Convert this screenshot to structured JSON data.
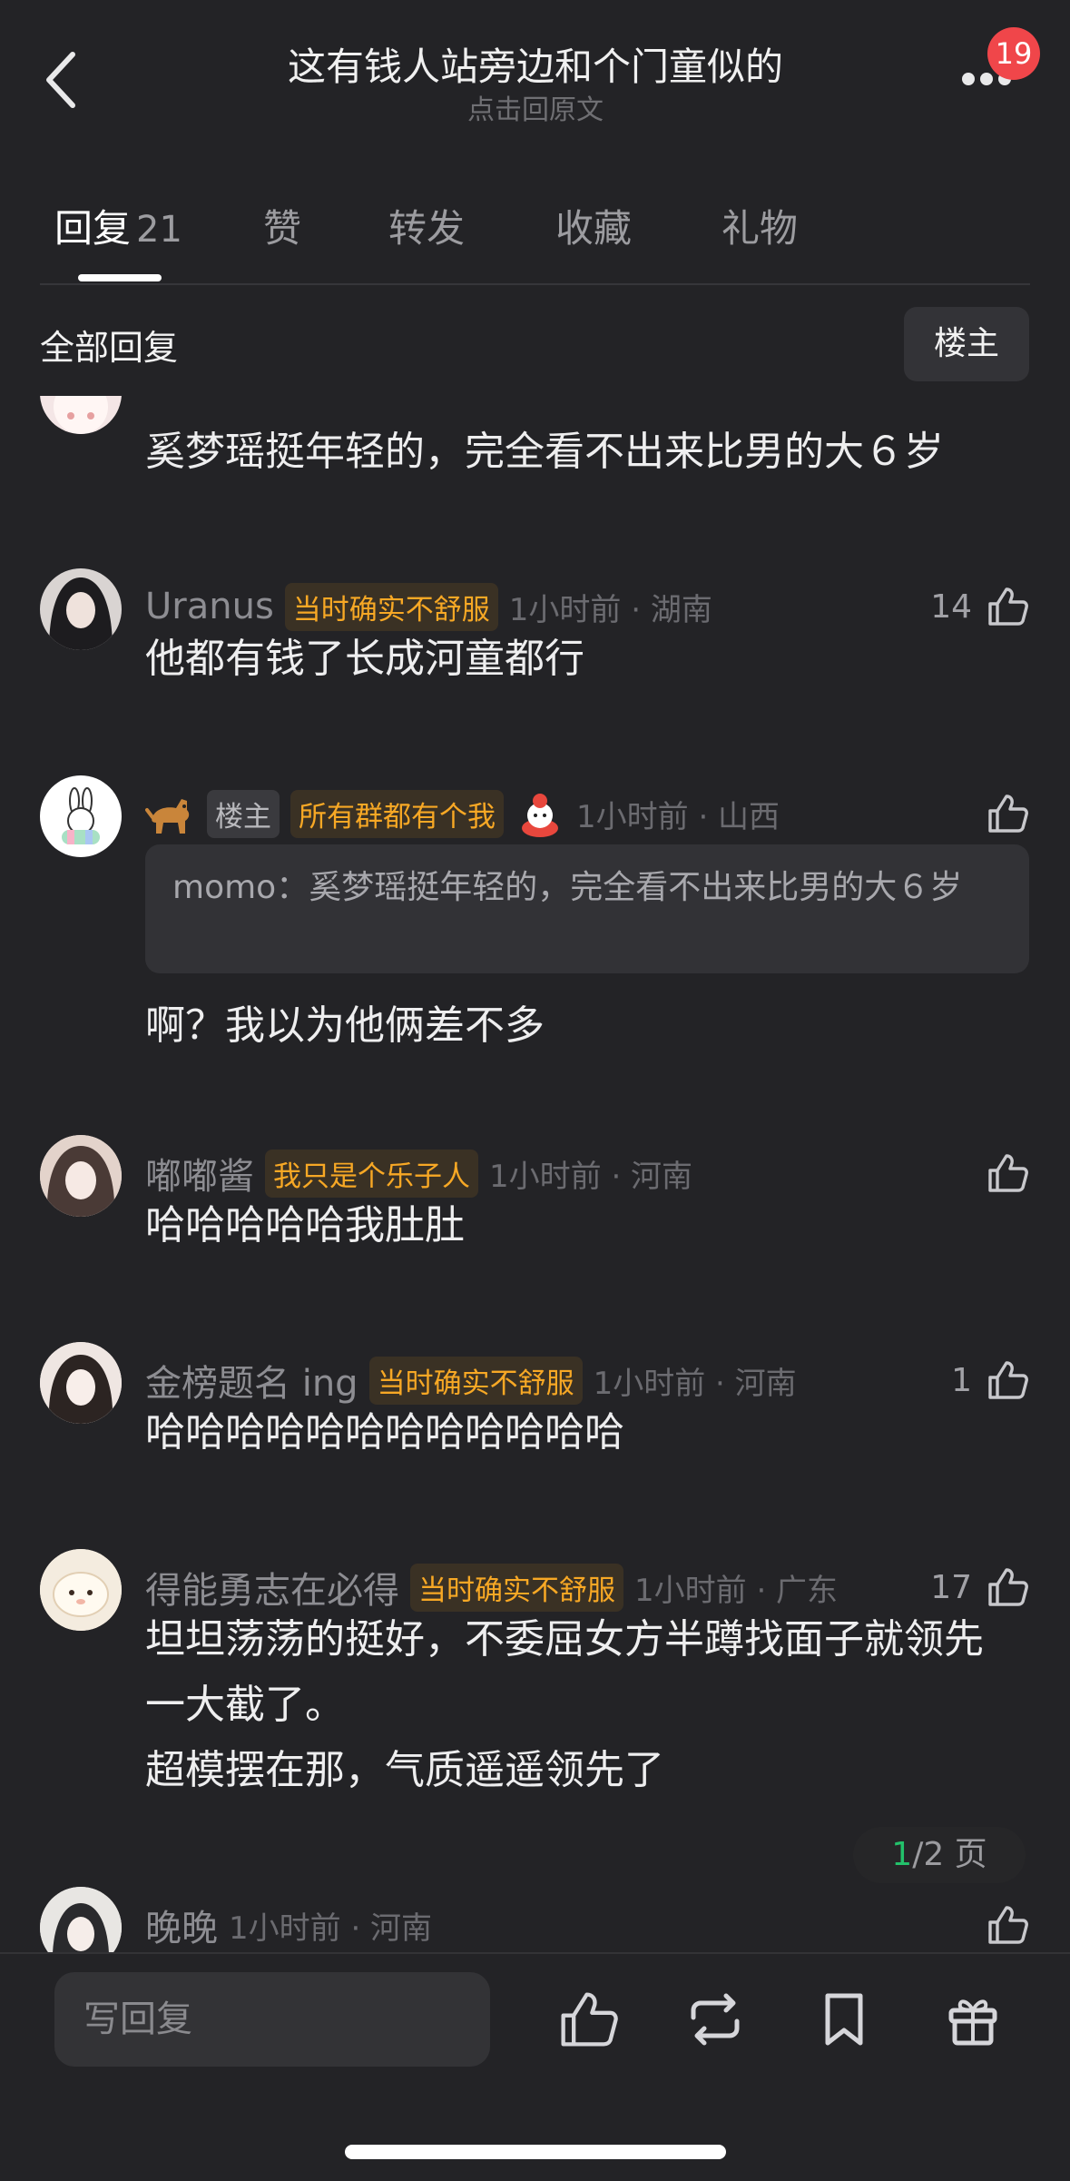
{
  "header": {
    "title": "这有钱人站旁边和个门童似的",
    "subtitle": "点击回原文",
    "notification_count": "19"
  },
  "tabs": [
    {
      "label": "回复",
      "count": "21"
    },
    {
      "label": "赞"
    },
    {
      "label": "转发"
    },
    {
      "label": "收藏"
    },
    {
      "label": "礼物"
    }
  ],
  "filter": {
    "all_replies": "全部回复",
    "op_button": "楼主"
  },
  "comments": [
    {
      "text": "奚梦瑶挺年轻的，完全看不出来比男的大６岁"
    },
    {
      "name": "Uranus",
      "tag": "当时确实不舒服",
      "time": "1小时前 · 湖南",
      "likes": "14",
      "text": "他都有钱了长成河童都行"
    },
    {
      "op_label": "楼主",
      "tag": "所有群都有个我",
      "time": "1小时前 · 山西",
      "quote": "momo：奚梦瑶挺年轻的，完全看不出来比男的大６岁",
      "text": "啊？我以为他俩差不多"
    },
    {
      "name": "嘟嘟酱",
      "tag": "我只是个乐子人",
      "time": "1小时前 · 河南",
      "text": "哈哈哈哈哈我肚肚"
    },
    {
      "name": "金榜题名 ing",
      "tag": "当时确实不舒服",
      "time": "1小时前 · 河南",
      "likes": "1",
      "text": "哈哈哈哈哈哈哈哈哈哈哈哈"
    },
    {
      "name": "得能勇志在必得",
      "tag": "当时确实不舒服",
      "time": "1小时前 · 广东",
      "likes": "17",
      "text": "坦坦荡荡的挺好，不委屈女方半蹲找面子就领先一大截了。",
      "text2": "超模摆在那，气质遥遥领先了"
    },
    {
      "name": "晚晚",
      "time": "1小时前 · 河南"
    }
  ],
  "pager": {
    "current": "1",
    "rest": "/2 页"
  },
  "bottom": {
    "reply_placeholder": "写回复"
  },
  "colors": {
    "background": "#232326",
    "tag": "#f7a825",
    "badge": "#f0464a",
    "pager_current": "#23c16b"
  }
}
